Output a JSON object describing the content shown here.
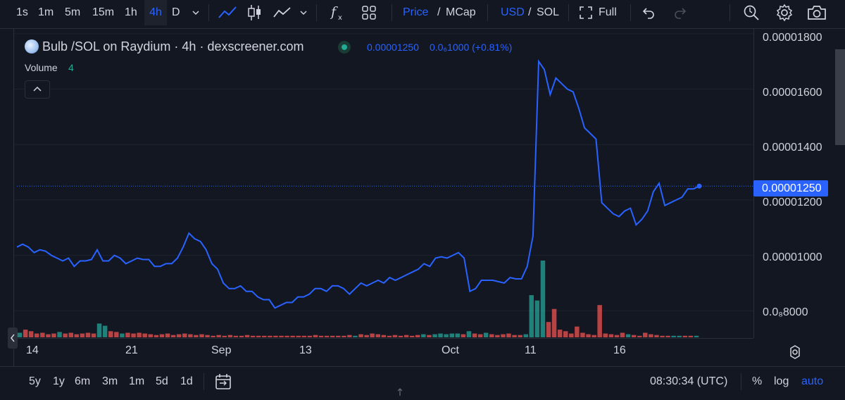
{
  "toolbar": {
    "intervals": [
      "1s",
      "1m",
      "5m",
      "15m",
      "1h",
      "4h",
      "D"
    ],
    "active_interval": "4h",
    "price_label": "Price",
    "slash1": "/",
    "mcap_label": "MCap",
    "usd_label": "USD",
    "slash2": "/",
    "sol_label": "SOL",
    "full_label": "Full"
  },
  "legend": {
    "title": "Bulb /SOL on Raydium · 4h · dexscreener.com",
    "price": "0.00001250",
    "change": "0.0₆1000 (+0.81%)",
    "volume_label": "Volume",
    "volume_value": "4"
  },
  "price_axis": {
    "ticks": [
      "0.00001800",
      "0.00001600",
      "0.00001400",
      "0.00001200",
      "0.00001000",
      "0.0₈8000"
    ],
    "current_price_tag": "0.00001250"
  },
  "time_axis": {
    "ticks": [
      "14",
      "21",
      "Sep",
      "13",
      "Oct",
      "11",
      "16"
    ]
  },
  "bottom": {
    "ranges": [
      "5y",
      "1y",
      "6m",
      "3m",
      "1m",
      "5d",
      "1d"
    ],
    "clock": "08:30:34 (UTC)",
    "percent": "%",
    "log": "log",
    "auto": "auto"
  },
  "colors": {
    "line": "#2962ff",
    "volume_up": "#26a69a",
    "volume_down": "#ef5350",
    "background": "#131722"
  },
  "chart_data": {
    "type": "line",
    "x_ticks": [
      "14",
      "21",
      "Sep",
      "13",
      "Oct",
      "11",
      "16"
    ],
    "ylim": [
      7.6e-06,
      1.82e-05
    ],
    "series": [
      {
        "values": [
          1.03e-05,
          1.04e-05,
          1.03e-05,
          1.01e-05,
          1.02e-05,
          1.015e-05,
          1e-05,
          9.9e-06,
          9.8e-06,
          9.9e-06,
          9.6e-06,
          9.8e-06,
          9.8e-06,
          9.85e-06,
          1.02e-05,
          9.8e-06,
          9.8e-06,
          1e-05,
          9.9e-06,
          9.7e-06,
          9.8e-06,
          9.9e-06,
          9.85e-06,
          9.85e-06,
          9.6e-06,
          9.6e-06,
          9.7e-06,
          9.7e-06,
          9.9e-06,
          1.03e-05,
          1.08e-05,
          1.06e-05,
          1.05e-05,
          1.02e-05,
          9.7e-06,
          9.5e-06,
          9e-06,
          8.8e-06,
          8.8e-06,
          8.9e-06,
          8.7e-06,
          8.7e-06,
          8.5e-06,
          8.4e-06,
          8.4e-06,
          8.1e-06,
          8.2e-06,
          8.3e-06,
          8.3e-06,
          8.5e-06,
          8.5e-06,
          8.6e-06,
          8.8e-06,
          8.8e-06,
          8.7e-06,
          8.9e-06,
          8.9e-06,
          8.8e-06,
          8.6e-06,
          8.8e-06,
          9e-06,
          8.9e-06,
          9e-06,
          9.1e-06,
          9e-06,
          9.2e-06,
          9.1e-06,
          9.2e-06,
          9.3e-06,
          9.4e-06,
          9.5e-06,
          9.7e-06,
          9.6e-06,
          9.9e-06,
          9.95e-06,
          9.9e-06,
          1e-05,
          1.01e-05,
          9.9e-06,
          8.7e-06,
          8.8e-06,
          9.1e-06,
          9.1e-06,
          9.1e-06,
          9.05e-06,
          9e-06,
          9.2e-06,
          9.15e-06,
          9.15e-06,
          9.6e-06,
          1.07e-05,
          1.7e-05,
          1.67e-05,
          1.58e-05,
          1.64e-05,
          1.62e-05,
          1.6e-05,
          1.59e-05,
          1.53e-05,
          1.46e-05,
          1.44e-05,
          1.42e-05,
          1.19e-05,
          1.17e-05,
          1.15e-05,
          1.14e-05,
          1.16e-05,
          1.17e-05,
          1.11e-05,
          1.13e-05,
          1.16e-05,
          1.23e-05,
          1.26e-05,
          1.18e-05,
          1.19e-05,
          1.2e-05,
          1.21e-05,
          1.24e-05,
          1.24e-05,
          1.25e-05
        ]
      }
    ],
    "volume": [
      {
        "v": 0.06,
        "up": true
      },
      {
        "v": 0.1,
        "up": false
      },
      {
        "v": 0.08,
        "up": false
      },
      {
        "v": 0.05,
        "up": false
      },
      {
        "v": 0.06,
        "up": false
      },
      {
        "v": 0.04,
        "up": false
      },
      {
        "v": 0.05,
        "up": false
      },
      {
        "v": 0.07,
        "up": true
      },
      {
        "v": 0.05,
        "up": false
      },
      {
        "v": 0.06,
        "up": false
      },
      {
        "v": 0.04,
        "up": false
      },
      {
        "v": 0.05,
        "up": false
      },
      {
        "v": 0.06,
        "up": false
      },
      {
        "v": 0.05,
        "up": false
      },
      {
        "v": 0.18,
        "up": true
      },
      {
        "v": 0.15,
        "up": true
      },
      {
        "v": 0.08,
        "up": false
      },
      {
        "v": 0.07,
        "up": false
      },
      {
        "v": 0.05,
        "up": true
      },
      {
        "v": 0.06,
        "up": false
      },
      {
        "v": 0.05,
        "up": false
      },
      {
        "v": 0.06,
        "up": false
      },
      {
        "v": 0.05,
        "up": false
      },
      {
        "v": 0.04,
        "up": false
      },
      {
        "v": 0.03,
        "up": false
      },
      {
        "v": 0.04,
        "up": false
      },
      {
        "v": 0.05,
        "up": false
      },
      {
        "v": 0.03,
        "up": false
      },
      {
        "v": 0.04,
        "up": false
      },
      {
        "v": 0.05,
        "up": false
      },
      {
        "v": 0.04,
        "up": false
      },
      {
        "v": 0.03,
        "up": false
      },
      {
        "v": 0.04,
        "up": false
      },
      {
        "v": 0.03,
        "up": false
      },
      {
        "v": 0.02,
        "up": false
      },
      {
        "v": 0.03,
        "up": false
      },
      {
        "v": 0.02,
        "up": false
      },
      {
        "v": 0.03,
        "up": false
      },
      {
        "v": 0.02,
        "up": false
      },
      {
        "v": 0.02,
        "up": false
      },
      {
        "v": 0.03,
        "up": false
      },
      {
        "v": 0.02,
        "up": false
      },
      {
        "v": 0.02,
        "up": false
      },
      {
        "v": 0.02,
        "up": false
      },
      {
        "v": 0.02,
        "up": false
      },
      {
        "v": 0.02,
        "up": false
      },
      {
        "v": 0.02,
        "up": false
      },
      {
        "v": 0.02,
        "up": false
      },
      {
        "v": 0.02,
        "up": false
      },
      {
        "v": 0.02,
        "up": false
      },
      {
        "v": 0.02,
        "up": false
      },
      {
        "v": 0.02,
        "up": false
      },
      {
        "v": 0.03,
        "up": false
      },
      {
        "v": 0.02,
        "up": false
      },
      {
        "v": 0.02,
        "up": false
      },
      {
        "v": 0.02,
        "up": false
      },
      {
        "v": 0.02,
        "up": false
      },
      {
        "v": 0.02,
        "up": false
      },
      {
        "v": 0.03,
        "up": false
      },
      {
        "v": 0.02,
        "up": true
      },
      {
        "v": 0.04,
        "up": false
      },
      {
        "v": 0.03,
        "up": false
      },
      {
        "v": 0.05,
        "up": false
      },
      {
        "v": 0.04,
        "up": false
      },
      {
        "v": 0.03,
        "up": false
      },
      {
        "v": 0.02,
        "up": false
      },
      {
        "v": 0.03,
        "up": false
      },
      {
        "v": 0.02,
        "up": false
      },
      {
        "v": 0.03,
        "up": false
      },
      {
        "v": 0.02,
        "up": false
      },
      {
        "v": 0.03,
        "up": false
      },
      {
        "v": 0.04,
        "up": true
      },
      {
        "v": 0.03,
        "up": false
      },
      {
        "v": 0.04,
        "up": true
      },
      {
        "v": 0.05,
        "up": true
      },
      {
        "v": 0.04,
        "up": true
      },
      {
        "v": 0.05,
        "up": true
      },
      {
        "v": 0.05,
        "up": true
      },
      {
        "v": 0.04,
        "up": false
      },
      {
        "v": 0.08,
        "up": true
      },
      {
        "v": 0.05,
        "up": false
      },
      {
        "v": 0.04,
        "up": false
      },
      {
        "v": 0.06,
        "up": true
      },
      {
        "v": 0.04,
        "up": false
      },
      {
        "v": 0.03,
        "up": false
      },
      {
        "v": 0.04,
        "up": false
      },
      {
        "v": 0.05,
        "up": false
      },
      {
        "v": 0.03,
        "up": false
      },
      {
        "v": 0.03,
        "up": false
      },
      {
        "v": 0.04,
        "up": true
      },
      {
        "v": 0.55,
        "up": true
      },
      {
        "v": 0.48,
        "up": true
      },
      {
        "v": 1.0,
        "up": true
      },
      {
        "v": 0.2,
        "up": false
      },
      {
        "v": 0.37,
        "up": false
      },
      {
        "v": 0.1,
        "up": false
      },
      {
        "v": 0.08,
        "up": false
      },
      {
        "v": 0.05,
        "up": false
      },
      {
        "v": 0.14,
        "up": false
      },
      {
        "v": 0.06,
        "up": false
      },
      {
        "v": 0.04,
        "up": false
      },
      {
        "v": 0.03,
        "up": false
      },
      {
        "v": 0.42,
        "up": false
      },
      {
        "v": 0.05,
        "up": false
      },
      {
        "v": 0.04,
        "up": false
      },
      {
        "v": 0.03,
        "up": false
      },
      {
        "v": 0.06,
        "up": false
      },
      {
        "v": 0.04,
        "up": true
      },
      {
        "v": 0.03,
        "up": false
      },
      {
        "v": 0.02,
        "up": false
      },
      {
        "v": 0.06,
        "up": false
      },
      {
        "v": 0.04,
        "up": false
      },
      {
        "v": 0.03,
        "up": false
      },
      {
        "v": 0.02,
        "up": false
      },
      {
        "v": 0.02,
        "up": false
      },
      {
        "v": 0.02,
        "up": true
      },
      {
        "v": 0.02,
        "up": true
      },
      {
        "v": 0.02,
        "up": false
      },
      {
        "v": 0.02,
        "up": false
      },
      {
        "v": 0.02,
        "up": true
      }
    ]
  }
}
